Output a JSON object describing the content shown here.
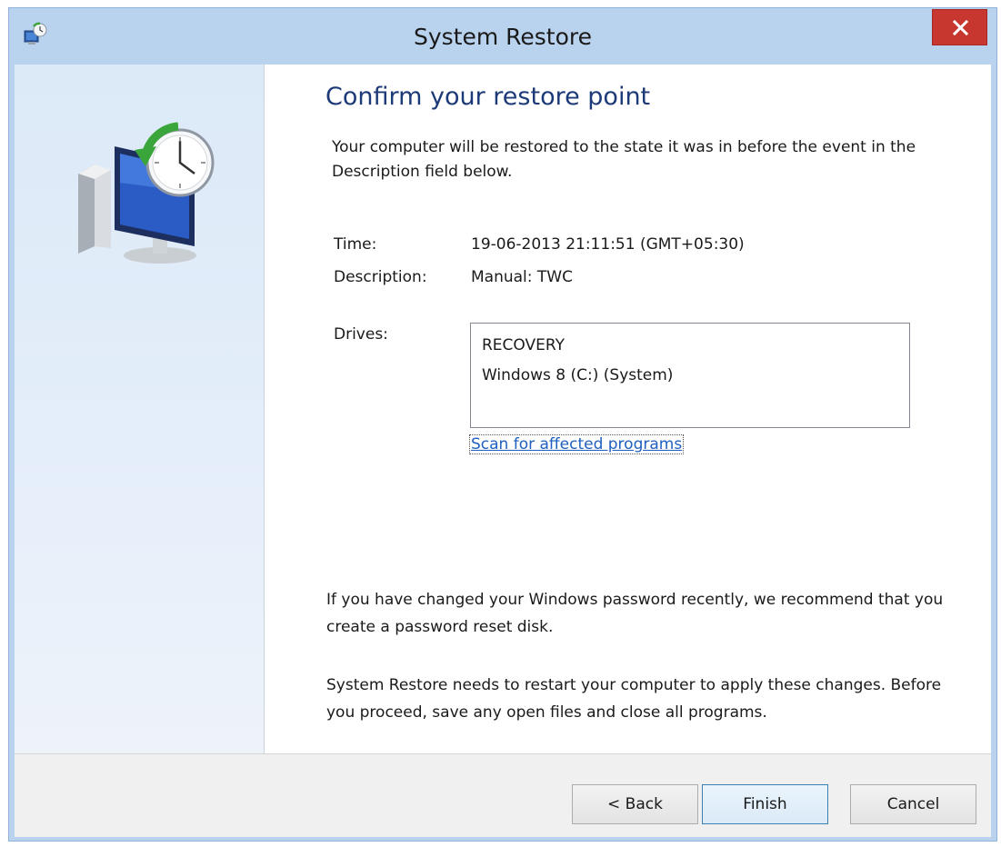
{
  "window": {
    "title": "System Restore",
    "close_glyph": "✕"
  },
  "icons": {
    "app": "system-restore-icon",
    "side": "restore-computer-clock-icon",
    "close": "close-icon"
  },
  "main": {
    "heading": "Confirm your restore point",
    "intro": "Your computer will be restored to the state it was in before the event in the Description field below.",
    "time_label": "Time:",
    "time_value": "19-06-2013 21:11:51 (GMT+05:30)",
    "description_label": "Description:",
    "description_value": "Manual: TWC",
    "drives_label": "Drives:",
    "drives": [
      "RECOVERY",
      "Windows 8 (C:) (System)"
    ],
    "scan_link": "Scan for affected programs",
    "password_note": "If you have changed your Windows password recently, we recommend that you create a password reset disk.",
    "restart_note": "System Restore needs to restart your computer to apply these changes. Before you proceed, save any open files and close all programs."
  },
  "buttons": {
    "back": "< Back",
    "finish": "Finish",
    "cancel": "Cancel"
  },
  "colors": {
    "title_bar": "#b9d3ee",
    "heading": "#1d3a78",
    "link": "#1f5fbf",
    "close_button": "#c7372f"
  }
}
